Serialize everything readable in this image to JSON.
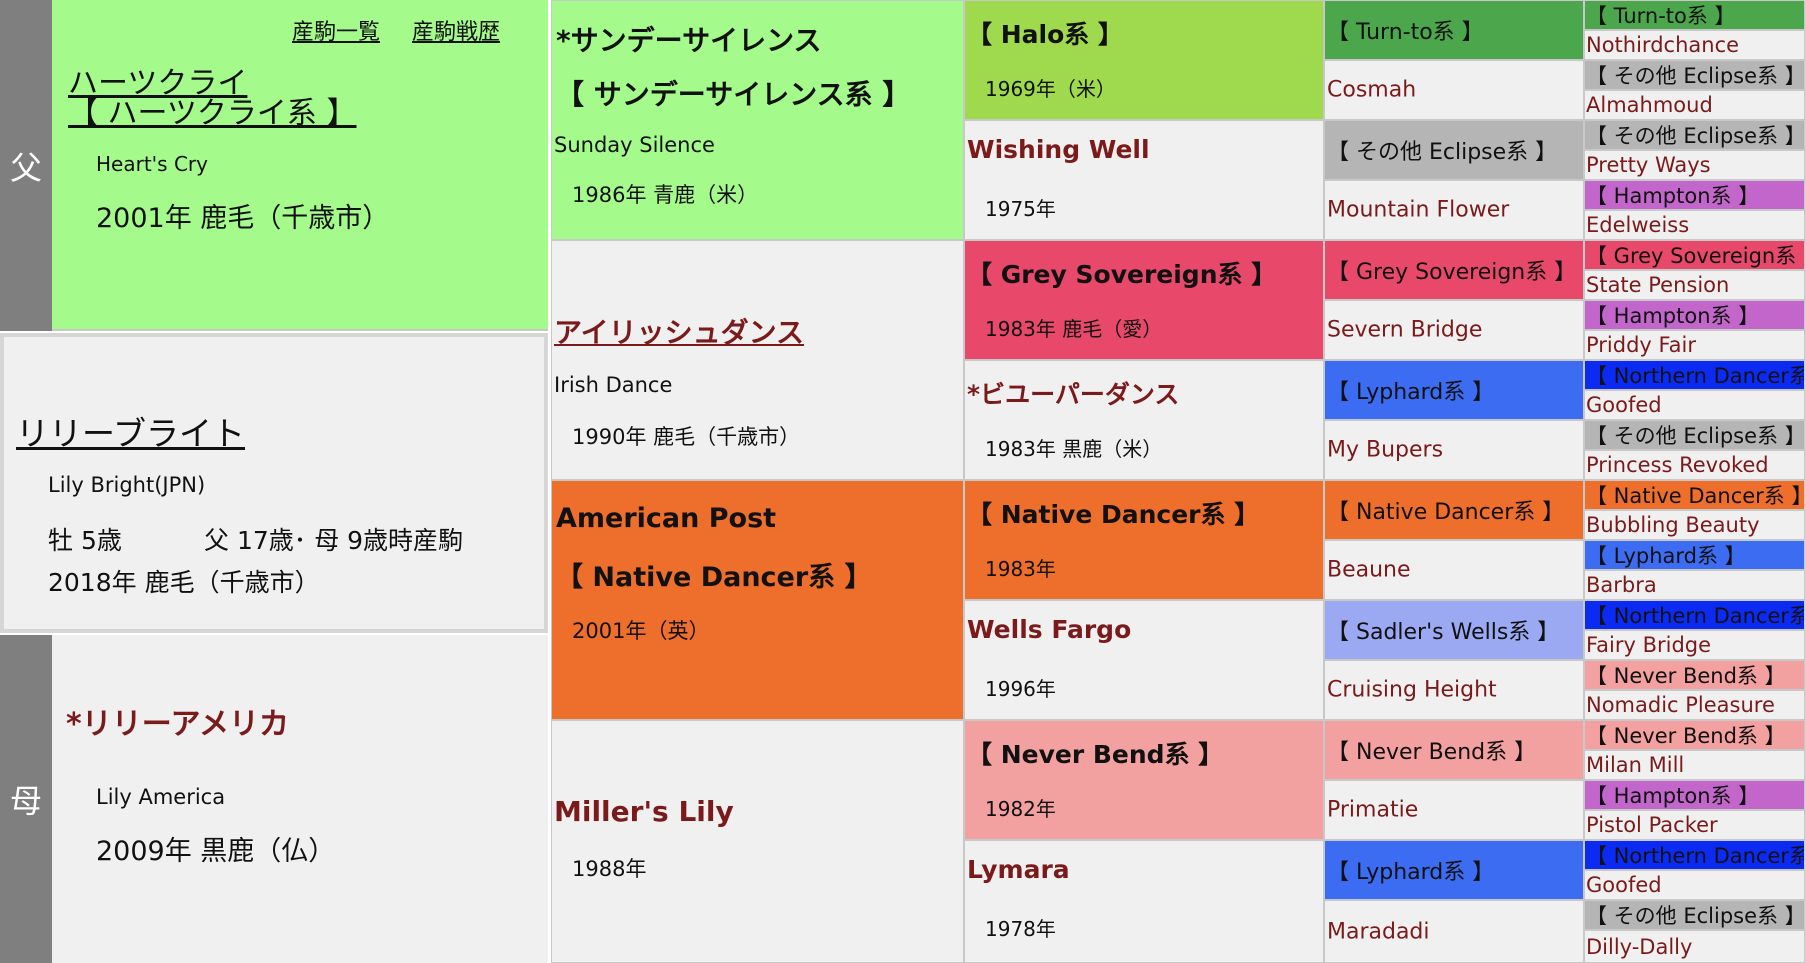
{
  "sire_label": "父",
  "dam_label": "母",
  "links": {
    "offspring": "産駒一覧",
    "race_record": "産駒戦歴"
  },
  "sire": {
    "name": "ハーツクライ",
    "line": "【 ハーツクライ系 】",
    "english": "Heart's Cry",
    "info": "2001年  鹿毛（千歳市）"
  },
  "horse": {
    "name": "リリーブライト",
    "english": "Lily Bright(JPN)",
    "sex_age": "牡  5歳",
    "parent_ages": "父 17歳･ 母 9歳時産駒",
    "birth": "2018年  鹿毛（千歳市）"
  },
  "dam": {
    "name": "*リリーアメリカ",
    "english": "Lily America",
    "info": "2009年  黒鹿（仏）"
  },
  "gen2": [
    {
      "name": "*サンデーサイレンス",
      "line": "【 サンデーサイレンス系 】",
      "english": "Sunday Silence",
      "info": "1986年  青鹿（米）",
      "bg": "#a5fa8c"
    },
    {
      "name": "アイリッシュダンス",
      "english": "Irish Dance",
      "info": "1990年  鹿毛（千歳市）",
      "bg": "#f0f0f0"
    },
    {
      "name": "American Post",
      "line": "【 Native Dancer系 】",
      "info": "2001年（英）",
      "bg": "#ee6e2c"
    },
    {
      "name": "Miller's Lily",
      "info": "1988年",
      "bg": "#f0f0f0"
    }
  ],
  "gen3": [
    {
      "name": "【 Halo系 】",
      "info": "1969年（米）",
      "bg": "#9fd94d",
      "color": "black"
    },
    {
      "name": "Wishing Well",
      "info": "1975年",
      "bg": "#f0f0f0",
      "color": "maroon"
    },
    {
      "name": "【 Grey Sovereign系 】",
      "info": "1983年  鹿毛（愛）",
      "bg": "#e8496a",
      "color": "black"
    },
    {
      "name": "*ビユーパーダンス",
      "info": "1983年  黒鹿（米）",
      "bg": "#f0f0f0",
      "color": "maroon"
    },
    {
      "name": "【 Native Dancer系 】",
      "info": "1983年",
      "bg": "#ee6e2c",
      "color": "black"
    },
    {
      "name": "Wells Fargo",
      "info": "1996年",
      "bg": "#f0f0f0",
      "color": "maroon"
    },
    {
      "name": "【 Never Bend系 】",
      "info": "1982年",
      "bg": "#f2a0a0",
      "color": "black"
    },
    {
      "name": "Lymara",
      "info": "1978年",
      "bg": "#f0f0f0",
      "color": "maroon"
    }
  ],
  "gen4": [
    {
      "text": "【 Turn-to系 】",
      "bg": "#4ca64c",
      "color": "black"
    },
    {
      "text": "Cosmah",
      "bg": "#f0f0f0",
      "color": "maroon"
    },
    {
      "text": "【 その他 Eclipse系 】",
      "bg": "#b5b5b5",
      "color": "black"
    },
    {
      "text": "Mountain Flower",
      "bg": "#f0f0f0",
      "color": "maroon"
    },
    {
      "text": "【 Grey Sovereign系 】",
      "bg": "#e8496a",
      "color": "black"
    },
    {
      "text": "Severn Bridge",
      "bg": "#f0f0f0",
      "color": "maroon"
    },
    {
      "text": "【 Lyphard系 】",
      "bg": "#3b6cf2",
      "color": "black"
    },
    {
      "text": "My Bupers",
      "bg": "#f0f0f0",
      "color": "maroon"
    },
    {
      "text": "【 Native Dancer系 】",
      "bg": "#ee6e2c",
      "color": "black"
    },
    {
      "text": "Beaune",
      "bg": "#f0f0f0",
      "color": "maroon"
    },
    {
      "text": "【 Sadler's Wells系 】",
      "bg": "#9ba8f2",
      "color": "black"
    },
    {
      "text": "Cruising Height",
      "bg": "#f0f0f0",
      "color": "maroon"
    },
    {
      "text": "【 Never Bend系 】",
      "bg": "#f2a0a0",
      "color": "black"
    },
    {
      "text": "Primatie",
      "bg": "#f0f0f0",
      "color": "maroon"
    },
    {
      "text": "【 Lyphard系 】",
      "bg": "#3b6cf2",
      "color": "black"
    },
    {
      "text": "Maradadi",
      "bg": "#f0f0f0",
      "color": "maroon"
    }
  ],
  "gen5": [
    {
      "text": "【 Turn-to系 】",
      "bg": "#4ca64c",
      "color": "black"
    },
    {
      "text": "Nothirdchance",
      "bg": "#f0f0f0",
      "color": "maroon"
    },
    {
      "text": "【 その他 Eclipse系 】",
      "bg": "#b5b5b5",
      "color": "black"
    },
    {
      "text": "Almahmoud",
      "bg": "#f0f0f0",
      "color": "maroon"
    },
    {
      "text": "【 その他 Eclipse系 】",
      "bg": "#b5b5b5",
      "color": "black"
    },
    {
      "text": "Pretty Ways",
      "bg": "#f0f0f0",
      "color": "maroon"
    },
    {
      "text": "【 Hampton系 】",
      "bg": "#c266cc",
      "color": "black"
    },
    {
      "text": "Edelweiss",
      "bg": "#f0f0f0",
      "color": "maroon"
    },
    {
      "text": "【 Grey Sovereign系 】",
      "bg": "#e8496a",
      "color": "black"
    },
    {
      "text": "State Pension",
      "bg": "#f0f0f0",
      "color": "maroon"
    },
    {
      "text": "【 Hampton系 】",
      "bg": "#c266cc",
      "color": "black"
    },
    {
      "text": "Priddy Fair",
      "bg": "#f0f0f0",
      "color": "maroon"
    },
    {
      "text": "【 Northern Dancer系 】",
      "bg": "#0b2bf2",
      "color": "black"
    },
    {
      "text": "Goofed",
      "bg": "#f0f0f0",
      "color": "maroon"
    },
    {
      "text": "【 その他 Eclipse系 】",
      "bg": "#b5b5b5",
      "color": "black"
    },
    {
      "text": "Princess Revoked",
      "bg": "#f0f0f0",
      "color": "maroon"
    },
    {
      "text": "【 Native Dancer系 】",
      "bg": "#ee6e2c",
      "color": "black"
    },
    {
      "text": "Bubbling Beauty",
      "bg": "#f0f0f0",
      "color": "maroon"
    },
    {
      "text": "【 Lyphard系 】",
      "bg": "#3b6cf2",
      "color": "black"
    },
    {
      "text": "Barbra",
      "bg": "#f0f0f0",
      "color": "maroon"
    },
    {
      "text": "【 Northern Dancer系 】",
      "bg": "#0b2bf2",
      "color": "black"
    },
    {
      "text": "Fairy Bridge",
      "bg": "#f0f0f0",
      "color": "maroon"
    },
    {
      "text": "【 Never Bend系 】",
      "bg": "#f2a0a0",
      "color": "black"
    },
    {
      "text": "Nomadic Pleasure",
      "bg": "#f0f0f0",
      "color": "maroon"
    },
    {
      "text": "【 Never Bend系 】",
      "bg": "#f2a0a0",
      "color": "black"
    },
    {
      "text": "Milan Mill",
      "bg": "#f0f0f0",
      "color": "maroon"
    },
    {
      "text": "【 Hampton系 】",
      "bg": "#c266cc",
      "color": "black"
    },
    {
      "text": "Pistol Packer",
      "bg": "#f0f0f0",
      "color": "maroon"
    },
    {
      "text": "【 Northern Dancer系 】",
      "bg": "#0b2bf2",
      "color": "black"
    },
    {
      "text": "Goofed",
      "bg": "#f0f0f0",
      "color": "maroon"
    },
    {
      "text": "【 その他 Eclipse系 】",
      "bg": "#b5b5b5",
      "color": "black"
    },
    {
      "text": "Dilly-Dally",
      "bg": "#f0f0f0",
      "color": "maroon"
    }
  ]
}
